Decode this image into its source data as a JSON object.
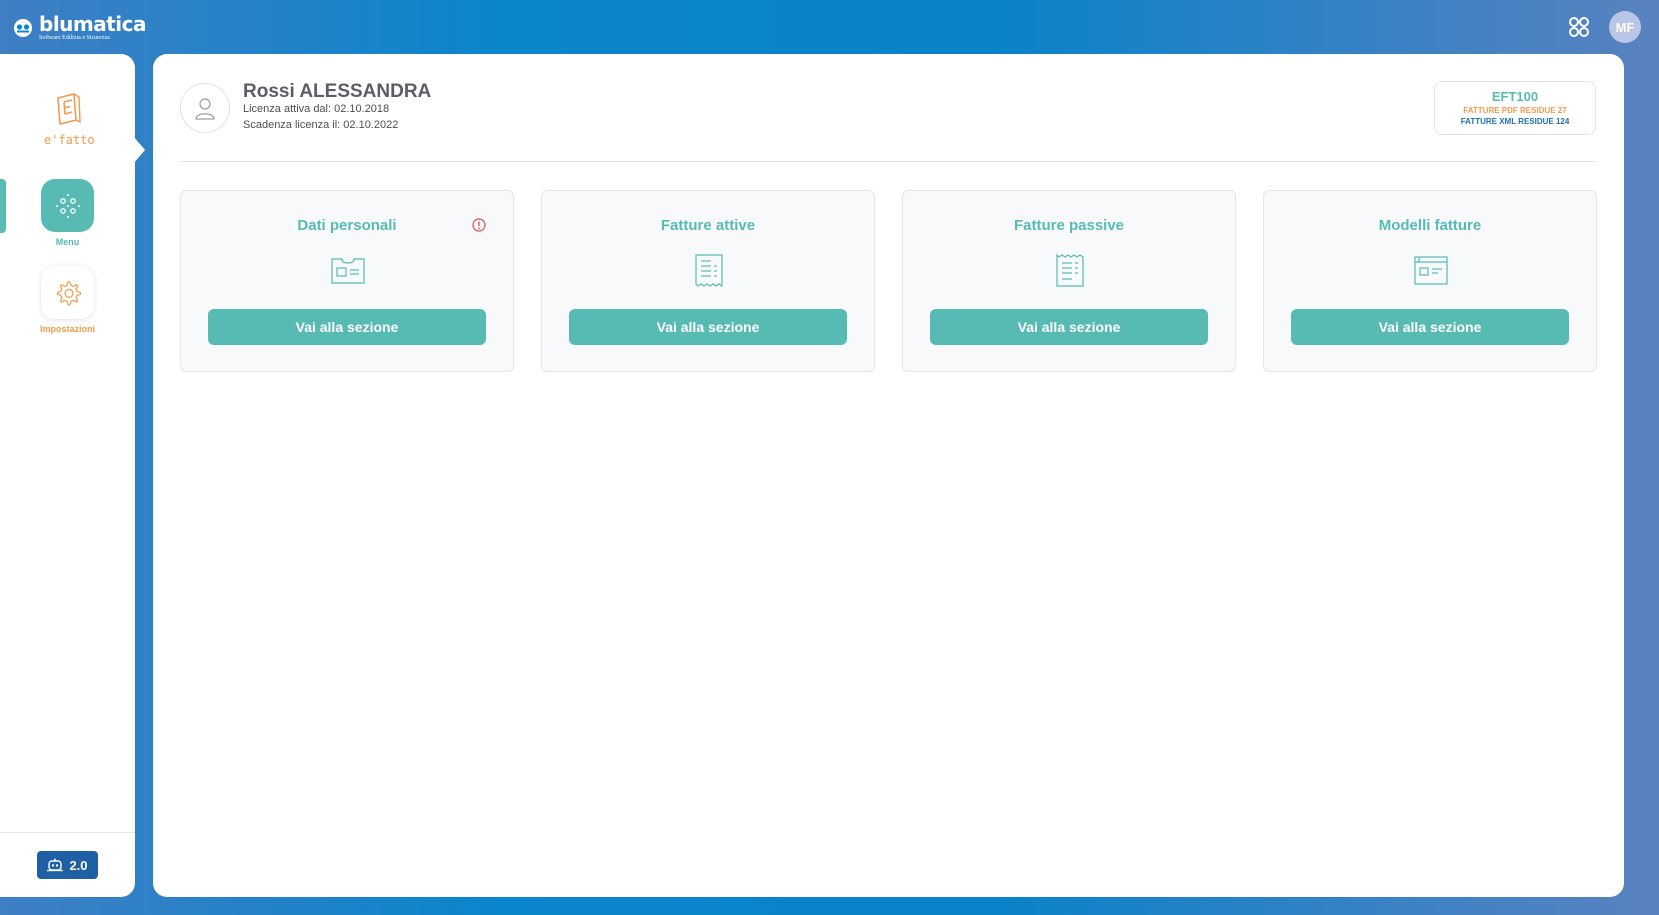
{
  "brand": {
    "name": "blumatica",
    "tagline": "Software Edilizia e Sicurezza"
  },
  "topbar": {
    "apps_icon": "apps-grid-icon",
    "user_initials": "MF"
  },
  "sidebar": {
    "product_name": "e'fatto",
    "items": [
      {
        "label": "Menu",
        "icon": "grid-dots-icon",
        "active": true
      },
      {
        "label": "Impostazioni",
        "icon": "gear-icon",
        "active": false
      }
    ],
    "version": "2.0"
  },
  "user": {
    "name": "Rossi ALESSANDRA",
    "license_active": "Licenza attiva dal: 02.10.2018",
    "license_expiry": "Scadenza licenza il: 02.10.2022"
  },
  "plan": {
    "code": "EFT100",
    "pdf_remaining": "FATTURE PDF RESIDUE 27",
    "xml_remaining": "FATTURE XML RESIDUE 124"
  },
  "cards": [
    {
      "title": "Dati personali",
      "button": "Vai alla sezione",
      "icon": "id-card-icon",
      "alert": true
    },
    {
      "title": "Fatture attive",
      "button": "Vai alla sezione",
      "icon": "receipt-icon",
      "alert": false
    },
    {
      "title": "Fatture passive",
      "button": "Vai alla sezione",
      "icon": "receipt-icon",
      "alert": false
    },
    {
      "title": "Modelli fatture",
      "button": "Vai alla sezione",
      "icon": "template-icon",
      "alert": false
    }
  ],
  "colors": {
    "accent": "#57bbb4",
    "orange": "#f39a4b",
    "blue": "#1f6fb0",
    "alert": "#e04a4a"
  }
}
